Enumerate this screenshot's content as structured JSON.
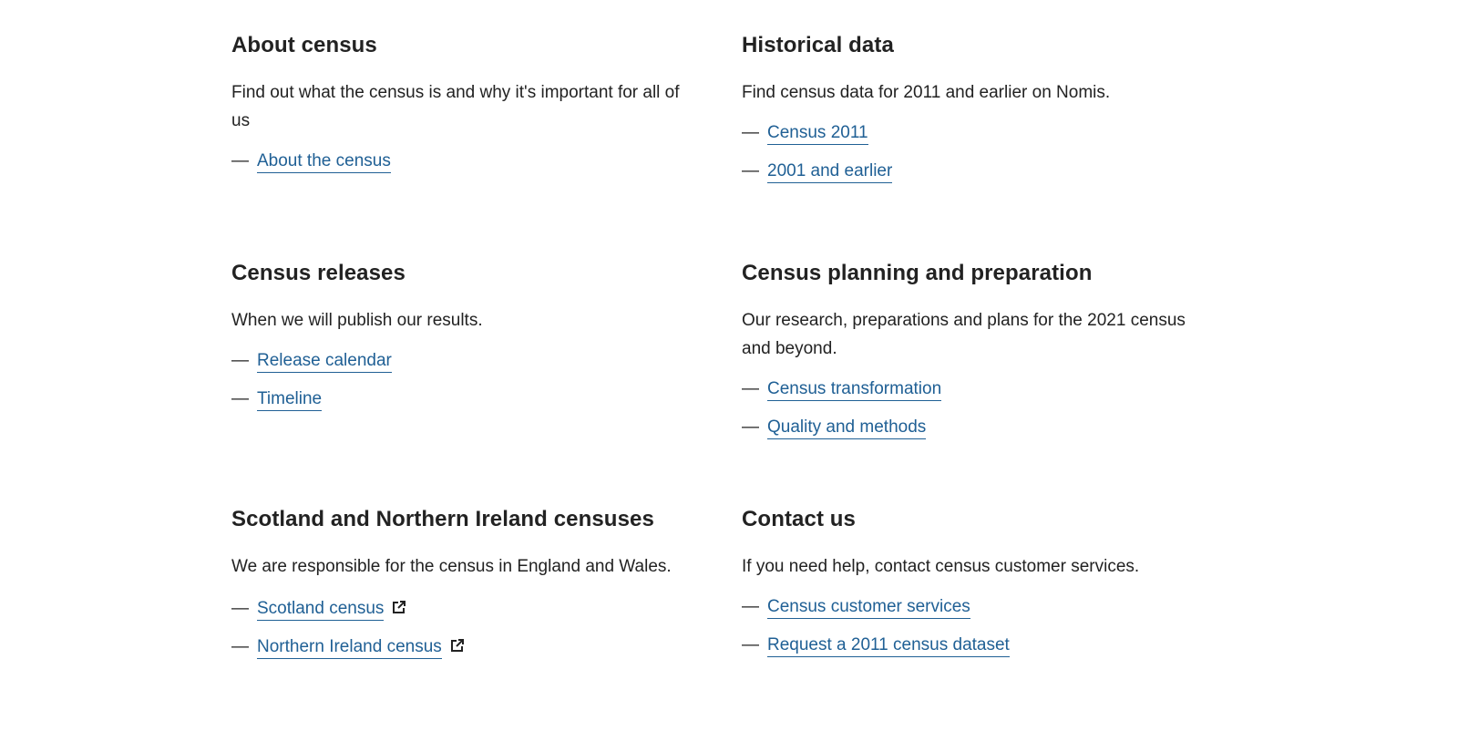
{
  "sections": [
    {
      "title": "About census",
      "description": "Find out what the census is and why it's important for all of us",
      "links": [
        {
          "label": "About the census"
        }
      ]
    },
    {
      "title": "Historical data",
      "description": "Find census data for 2011 and earlier on Nomis.",
      "links": [
        {
          "label": "Census 2011"
        },
        {
          "label": "2001 and earlier"
        }
      ]
    },
    {
      "title": "Census releases",
      "description": "When we will publish our results.",
      "links": [
        {
          "label": "Release calendar"
        },
        {
          "label": "Timeline"
        }
      ]
    },
    {
      "title": "Census planning and preparation",
      "description": "Our research, preparations and plans for the 2021 census and beyond.",
      "links": [
        {
          "label": "Census transformation"
        },
        {
          "label": "Quality and methods"
        }
      ]
    },
    {
      "title": "Scotland and Northern Ireland censuses",
      "description": "We are responsible for the census in England and Wales.",
      "links": [
        {
          "label": "Scotland census",
          "icon": "external-link-icon"
        },
        {
          "label": "Northern Ireland census",
          "icon": "external-link-icon"
        }
      ]
    },
    {
      "title": "Contact us",
      "description": "If you need help, contact census customer services.",
      "links": [
        {
          "label": "Census customer services"
        },
        {
          "label": "Request a 2011 census dataset"
        }
      ]
    }
  ],
  "dash_symbol": "—",
  "colors": {
    "link": "#206095",
    "text": "#222222",
    "background": "#ffffff"
  }
}
